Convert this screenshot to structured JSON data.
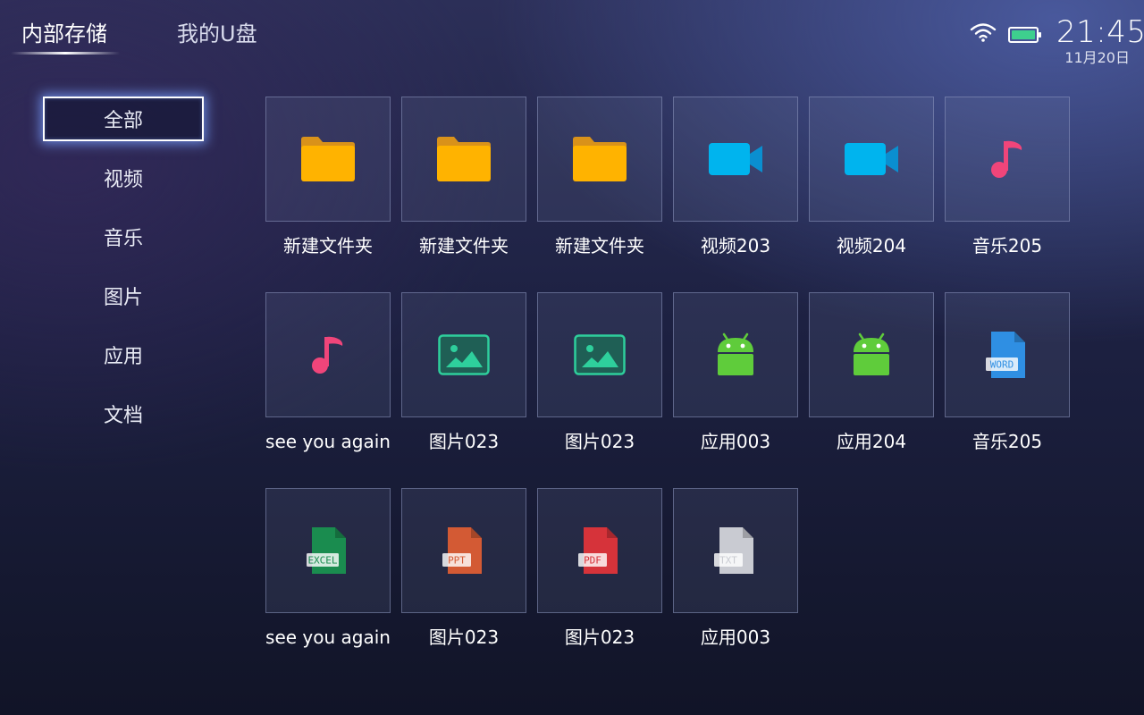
{
  "tabs": [
    {
      "label": "内部存储",
      "active": true
    },
    {
      "label": "我的U盘",
      "active": false
    }
  ],
  "status": {
    "time": "21:45",
    "date": "11月20日",
    "wifi_icon": "wifi-icon",
    "battery_icon": "battery-icon",
    "battery_color": "#3ecf8e"
  },
  "sidebar": {
    "items": [
      {
        "label": "全部",
        "active": true
      },
      {
        "label": "视频"
      },
      {
        "label": "音乐"
      },
      {
        "label": "图片"
      },
      {
        "label": "应用"
      },
      {
        "label": "文档"
      }
    ]
  },
  "files": [
    {
      "name": "新建文件夹",
      "icon": "folder-icon"
    },
    {
      "name": "新建文件夹",
      "icon": "folder-icon"
    },
    {
      "name": "新建文件夹",
      "icon": "folder-icon"
    },
    {
      "name": "视频203",
      "icon": "video-icon"
    },
    {
      "name": "视频204",
      "icon": "video-icon"
    },
    {
      "name": "音乐205",
      "icon": "music-icon"
    },
    {
      "name": "see you again",
      "icon": "music-icon"
    },
    {
      "name": "图片023",
      "icon": "image-icon"
    },
    {
      "name": "图片023",
      "icon": "image-icon"
    },
    {
      "name": "应用003",
      "icon": "android-icon"
    },
    {
      "name": "应用204",
      "icon": "android-icon"
    },
    {
      "name": "音乐205",
      "icon": "word-doc-icon",
      "badge": "WORD"
    },
    {
      "name": "see you again",
      "icon": "excel-doc-icon",
      "badge": "EXCEL"
    },
    {
      "name": "图片023",
      "icon": "ppt-doc-icon",
      "badge": "PPT"
    },
    {
      "name": "图片023",
      "icon": "pdf-doc-icon",
      "badge": "PDF"
    },
    {
      "name": "应用003",
      "icon": "txt-doc-icon",
      "badge": "TXT"
    }
  ],
  "colors": {
    "folder": "#ffb300",
    "folder_tab": "#d9921a",
    "video": "#00b4ee",
    "video_dark": "#0a8fd0",
    "music": "#f0457a",
    "image": "#2ecf9c",
    "android": "#5fcc3b",
    "word": "#2f8fe3",
    "excel": "#1a8c4f",
    "ppt": "#d35a34",
    "pdf": "#d6333a",
    "txt": "#c9cbd2"
  }
}
